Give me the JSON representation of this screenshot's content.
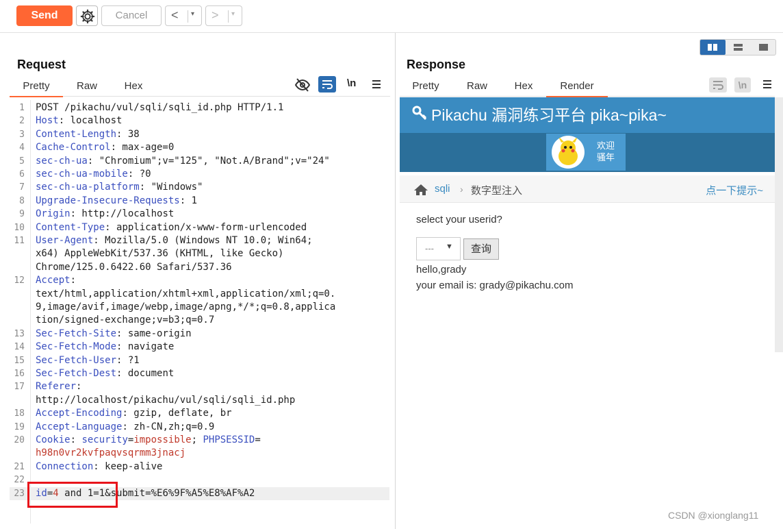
{
  "toolbar": {
    "send_label": "Send",
    "cancel_label": "Cancel",
    "back_arrow": "<",
    "forward_arrow": ">",
    "dropdown_glyph": "▾"
  },
  "request": {
    "title": "Request",
    "tabs": [
      "Pretty",
      "Raw",
      "Hex"
    ],
    "active_tab": "Pretty",
    "newline_label": "\\n"
  },
  "response": {
    "title": "Response",
    "tabs": [
      "Pretty",
      "Raw",
      "Hex",
      "Render"
    ],
    "active_tab": "Render",
    "newline_label": "\\n"
  },
  "editor_lines": [
    {
      "n": "1",
      "t": [
        [
          "POST /pikachu/vul/sqli/sqli_id.php HTTP/1.1",
          ""
        ]
      ]
    },
    {
      "n": "2",
      "t": [
        [
          "Host",
          "k"
        ],
        [
          ": localhost",
          ""
        ]
      ]
    },
    {
      "n": "3",
      "t": [
        [
          "Content-Length",
          "k"
        ],
        [
          ": 38",
          ""
        ]
      ]
    },
    {
      "n": "4",
      "t": [
        [
          "Cache-Control",
          "k"
        ],
        [
          ": max-age=0",
          ""
        ]
      ]
    },
    {
      "n": "5",
      "t": [
        [
          "sec-ch-ua",
          "k"
        ],
        [
          ": \"Chromium\";v=\"125\", \"Not.A/Brand\";v=\"24\"",
          ""
        ]
      ]
    },
    {
      "n": "6",
      "t": [
        [
          "sec-ch-ua-mobile",
          "k"
        ],
        [
          ": ?0",
          ""
        ]
      ]
    },
    {
      "n": "7",
      "t": [
        [
          "sec-ch-ua-platform",
          "k"
        ],
        [
          ": \"Windows\"",
          ""
        ]
      ]
    },
    {
      "n": "8",
      "t": [
        [
          "Upgrade-Insecure-Requests",
          "k"
        ],
        [
          ": 1",
          ""
        ]
      ]
    },
    {
      "n": "9",
      "t": [
        [
          "Origin",
          "k"
        ],
        [
          ": http://localhost",
          ""
        ]
      ]
    },
    {
      "n": "10",
      "t": [
        [
          "Content-Type",
          "k"
        ],
        [
          ": application/x-www-form-urlencoded",
          ""
        ]
      ]
    },
    {
      "n": "11",
      "t": [
        [
          "User-Agent",
          "k"
        ],
        [
          ": Mozilla/5.0 (Windows NT 10.0; Win64;",
          ""
        ]
      ]
    },
    {
      "n": "",
      "t": [
        [
          "x64) AppleWebKit/537.36 (KHTML, like Gecko)",
          ""
        ]
      ]
    },
    {
      "n": "",
      "t": [
        [
          "Chrome/125.0.6422.60 Safari/537.36",
          ""
        ]
      ]
    },
    {
      "n": "12",
      "t": [
        [
          "Accept",
          "k"
        ],
        [
          ":",
          ""
        ]
      ]
    },
    {
      "n": "",
      "t": [
        [
          "text/html,application/xhtml+xml,application/xml;q=0.",
          ""
        ]
      ]
    },
    {
      "n": "",
      "t": [
        [
          "9,image/avif,image/webp,image/apng,*/*;q=0.8,applica",
          ""
        ]
      ]
    },
    {
      "n": "",
      "t": [
        [
          "tion/signed-exchange;v=b3;q=0.7",
          ""
        ]
      ]
    },
    {
      "n": "13",
      "t": [
        [
          "Sec-Fetch-Site",
          "k"
        ],
        [
          ": same-origin",
          ""
        ]
      ]
    },
    {
      "n": "14",
      "t": [
        [
          "Sec-Fetch-Mode",
          "k"
        ],
        [
          ": navigate",
          ""
        ]
      ]
    },
    {
      "n": "15",
      "t": [
        [
          "Sec-Fetch-User",
          "k"
        ],
        [
          ": ?1",
          ""
        ]
      ]
    },
    {
      "n": "16",
      "t": [
        [
          "Sec-Fetch-Dest",
          "k"
        ],
        [
          ": document",
          ""
        ]
      ]
    },
    {
      "n": "17",
      "t": [
        [
          "Referer",
          "k"
        ],
        [
          ":",
          ""
        ]
      ]
    },
    {
      "n": "",
      "t": [
        [
          "http://localhost/pikachu/vul/sqli/sqli_id.php",
          ""
        ]
      ]
    },
    {
      "n": "18",
      "t": [
        [
          "Accept-Encoding",
          "k"
        ],
        [
          ": gzip, deflate, br",
          ""
        ]
      ]
    },
    {
      "n": "19",
      "t": [
        [
          "Accept-Language",
          "k"
        ],
        [
          ": zh-CN,zh;q=0.9",
          ""
        ]
      ]
    },
    {
      "n": "20",
      "t": [
        [
          "Cookie",
          "k"
        ],
        [
          ": ",
          ""
        ],
        [
          "security",
          "k"
        ],
        [
          "=",
          ""
        ],
        [
          "impossible",
          "r"
        ],
        [
          "; ",
          ""
        ],
        [
          "PHPSESSID",
          "k"
        ],
        [
          "=",
          ""
        ]
      ]
    },
    {
      "n": "",
      "t": [
        [
          "h98n0vr2kvfpaqvsqrmm3jnacj",
          "r"
        ]
      ]
    },
    {
      "n": "21",
      "t": [
        [
          "Connection",
          "k"
        ],
        [
          ": keep-alive",
          ""
        ]
      ]
    },
    {
      "n": "22",
      "t": []
    },
    {
      "n": "23",
      "t": [
        [
          "id",
          "k"
        ],
        [
          "=",
          ""
        ],
        [
          "4",
          "r"
        ],
        [
          " and 1=1&submit=%E6%9F%A5%E8%AF%A2",
          ""
        ]
      ]
    }
  ],
  "render": {
    "header_title": "Pikachu 漏洞练习平台 pika~pika~",
    "welcome_line1": "欢迎",
    "welcome_line2": "骚年",
    "crumb_link": "sqli",
    "crumb_sep": "›",
    "crumb_current": "数字型注入",
    "hint_link": "点一下提示~",
    "prompt": "select your userid?",
    "select_value": "---",
    "query_button": "查询",
    "result_line1": "hello,grady",
    "result_line2": "your email is: grady@pikachu.com"
  },
  "watermark": "CSDN @xionglang11",
  "colors": {
    "send": "#ff6633",
    "header": "#3a8bc1",
    "bar": "#2b6f9a",
    "key": "#3a4fbf",
    "value": "#c0392b",
    "highlight_box": "#e8141b"
  }
}
